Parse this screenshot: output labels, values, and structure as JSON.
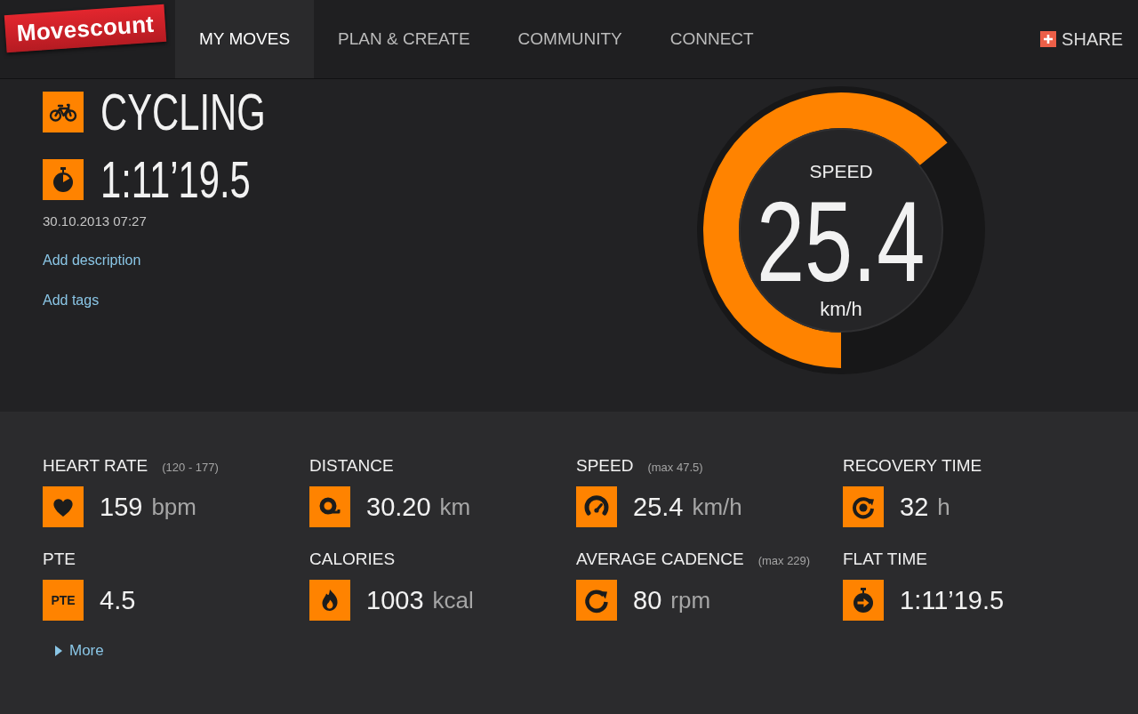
{
  "header": {
    "logo": "Movescount",
    "nav": [
      {
        "label": "MY MOVES",
        "selected": true
      },
      {
        "label": "PLAN & CREATE",
        "selected": false
      },
      {
        "label": "COMMUNITY",
        "selected": false
      },
      {
        "label": "CONNECT",
        "selected": false
      }
    ],
    "share": "SHARE"
  },
  "move": {
    "sport": "CYCLING",
    "duration": "1:11’19.5",
    "datetime": "30.10.2013 07:27",
    "links": [
      "Add description",
      "Add tags"
    ]
  },
  "gauge": {
    "label": "SPEED",
    "value": "25.4",
    "unit": "km/h",
    "level": 0.64
  },
  "stats": [
    {
      "kind": "heart",
      "label": "HEART RATE",
      "note": "(120 - 177)",
      "value": "159",
      "unit": "bpm"
    },
    {
      "kind": "distance",
      "label": "DISTANCE",
      "value": "30.20",
      "unit": "km"
    },
    {
      "kind": "speed",
      "label": "SPEED",
      "note": "(max 47.5)",
      "value": "25.4",
      "unit": "km/h"
    },
    {
      "kind": "recovery",
      "label": "RECOVERY TIME",
      "value": "32",
      "unit": "h"
    },
    {
      "kind": "pte",
      "label": "PTE",
      "badge": "PTE",
      "value": "4.5"
    },
    {
      "kind": "calories",
      "label": "CALORIES",
      "value": "1003",
      "unit": "kcal"
    },
    {
      "kind": "cadence",
      "label": "AVERAGE CADENCE",
      "note": "(max 229)",
      "value": "80",
      "unit": "rpm"
    },
    {
      "kind": "flat-time",
      "label": "FLAT TIME",
      "value": "1:11’19.5"
    }
  ],
  "more": "More"
}
